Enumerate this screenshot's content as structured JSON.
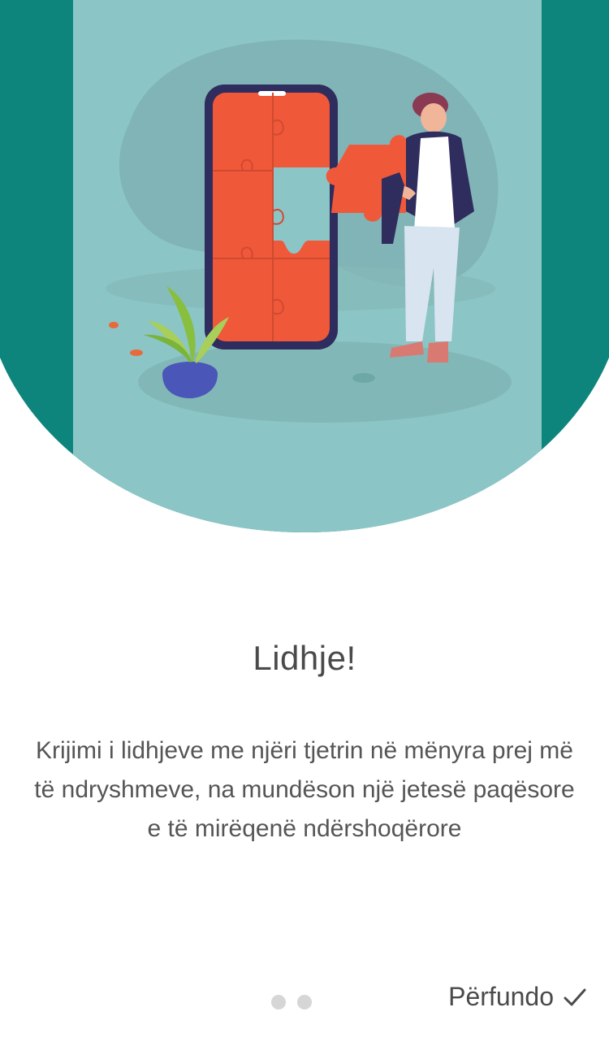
{
  "onboarding": {
    "illustration": {
      "icon": "puzzle-phone-illustration",
      "colors": {
        "teal_dark": "#0e857c",
        "teal_light": "#8cc5c6",
        "puzzle": "#f0583a",
        "phone_frame": "#2f2c5e"
      }
    },
    "title": "Lidhje!",
    "description": "Krijimi i lidhjeve me njëri tjetrin në mënyra prej më të ndryshmeve, na mundëson një jetesë paqësore e të mirëqenë ndërshoqërore",
    "pager": {
      "total": 2
    },
    "finish_label": "Përfundo",
    "finish_icon": "check-icon"
  }
}
